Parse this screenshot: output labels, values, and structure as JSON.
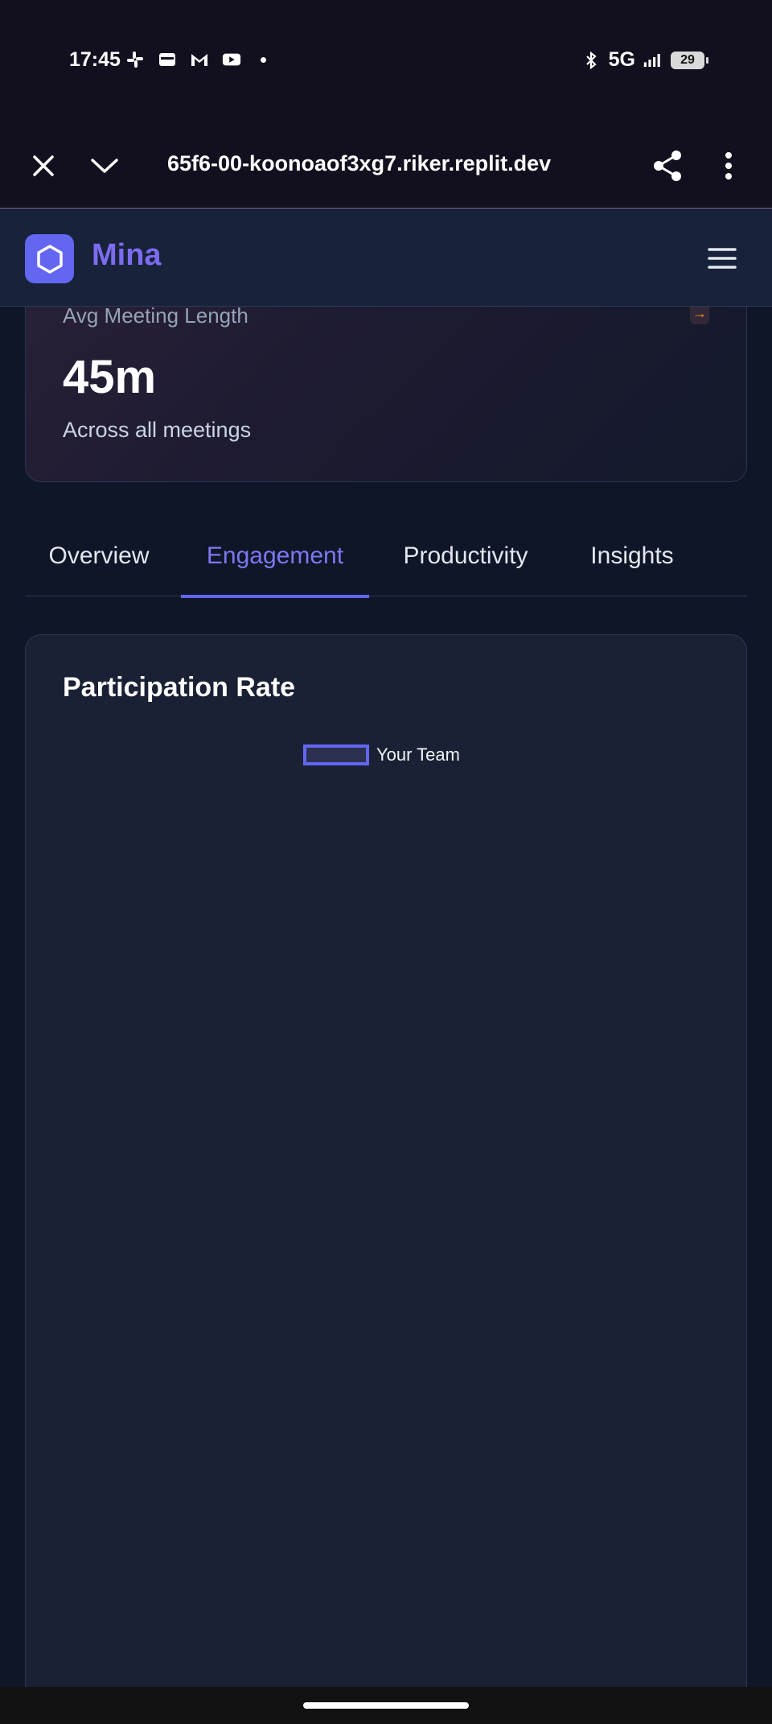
{
  "status_bar": {
    "time": "17:45",
    "network": "5G",
    "battery": "29",
    "left_icons": [
      "slack-icon",
      "wallet-icon",
      "gmail-icon",
      "youtube-icon"
    ],
    "right_icons": [
      "bluetooth-icon",
      "signal-icon",
      "battery-icon"
    ]
  },
  "browser": {
    "url": "65f6-00-koonoaof3xg7.riker.replit.dev",
    "close_icon": "close-icon",
    "expand_icon": "chevron-down-icon",
    "share_icon": "share-icon",
    "more_icon": "more-vertical-icon"
  },
  "app": {
    "name": "Mina",
    "logo_icon": "hexagon-icon",
    "menu_icon": "hamburger-menu-icon",
    "accent": "#6366f1"
  },
  "stat_card": {
    "label": "Avg Meeting Length",
    "value": "45m",
    "subtitle": "Across all meetings",
    "arrow": "→"
  },
  "tabs": [
    {
      "label": "Overview",
      "active": false
    },
    {
      "label": "Engagement",
      "active": true
    },
    {
      "label": "Productivity",
      "active": false
    },
    {
      "label": "Insights",
      "active": false
    }
  ],
  "chart": {
    "title": "Participation Rate",
    "legend_label": "Your Team"
  },
  "chart_data": {
    "type": "bar",
    "title": "Participation Rate",
    "series": [
      {
        "name": "Your Team",
        "values": []
      }
    ],
    "categories": []
  }
}
